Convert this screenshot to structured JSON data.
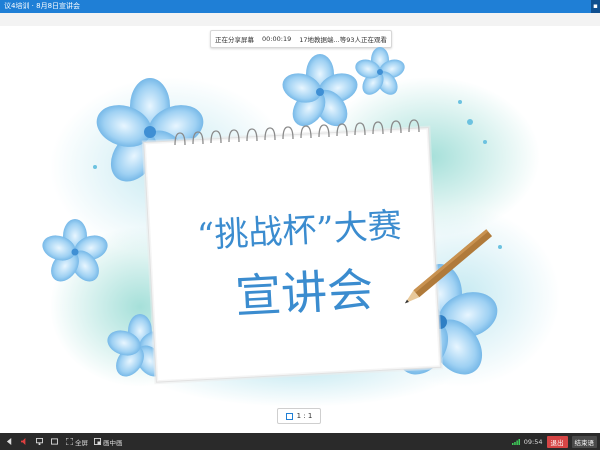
{
  "window": {
    "title": "议4培训 · 8月8日宣讲会"
  },
  "status_bar": {
    "sharing": "正在分享屏幕",
    "timer": "00:00:19",
    "viewers": "17地教据端...等93人正在观看"
  },
  "slide": {
    "line1": "“挑战杯”大赛",
    "line2": "宣讲会"
  },
  "zoom": {
    "label": "1 : 1"
  },
  "toolbar": {
    "fullscreen": "全屏",
    "pip": "画中画",
    "time": "09:54",
    "exit": "退出",
    "end": "结束语"
  },
  "colors": {
    "accent": "#1f7fd6",
    "slide_text": "#3b8ccf",
    "exit": "#d64545"
  }
}
